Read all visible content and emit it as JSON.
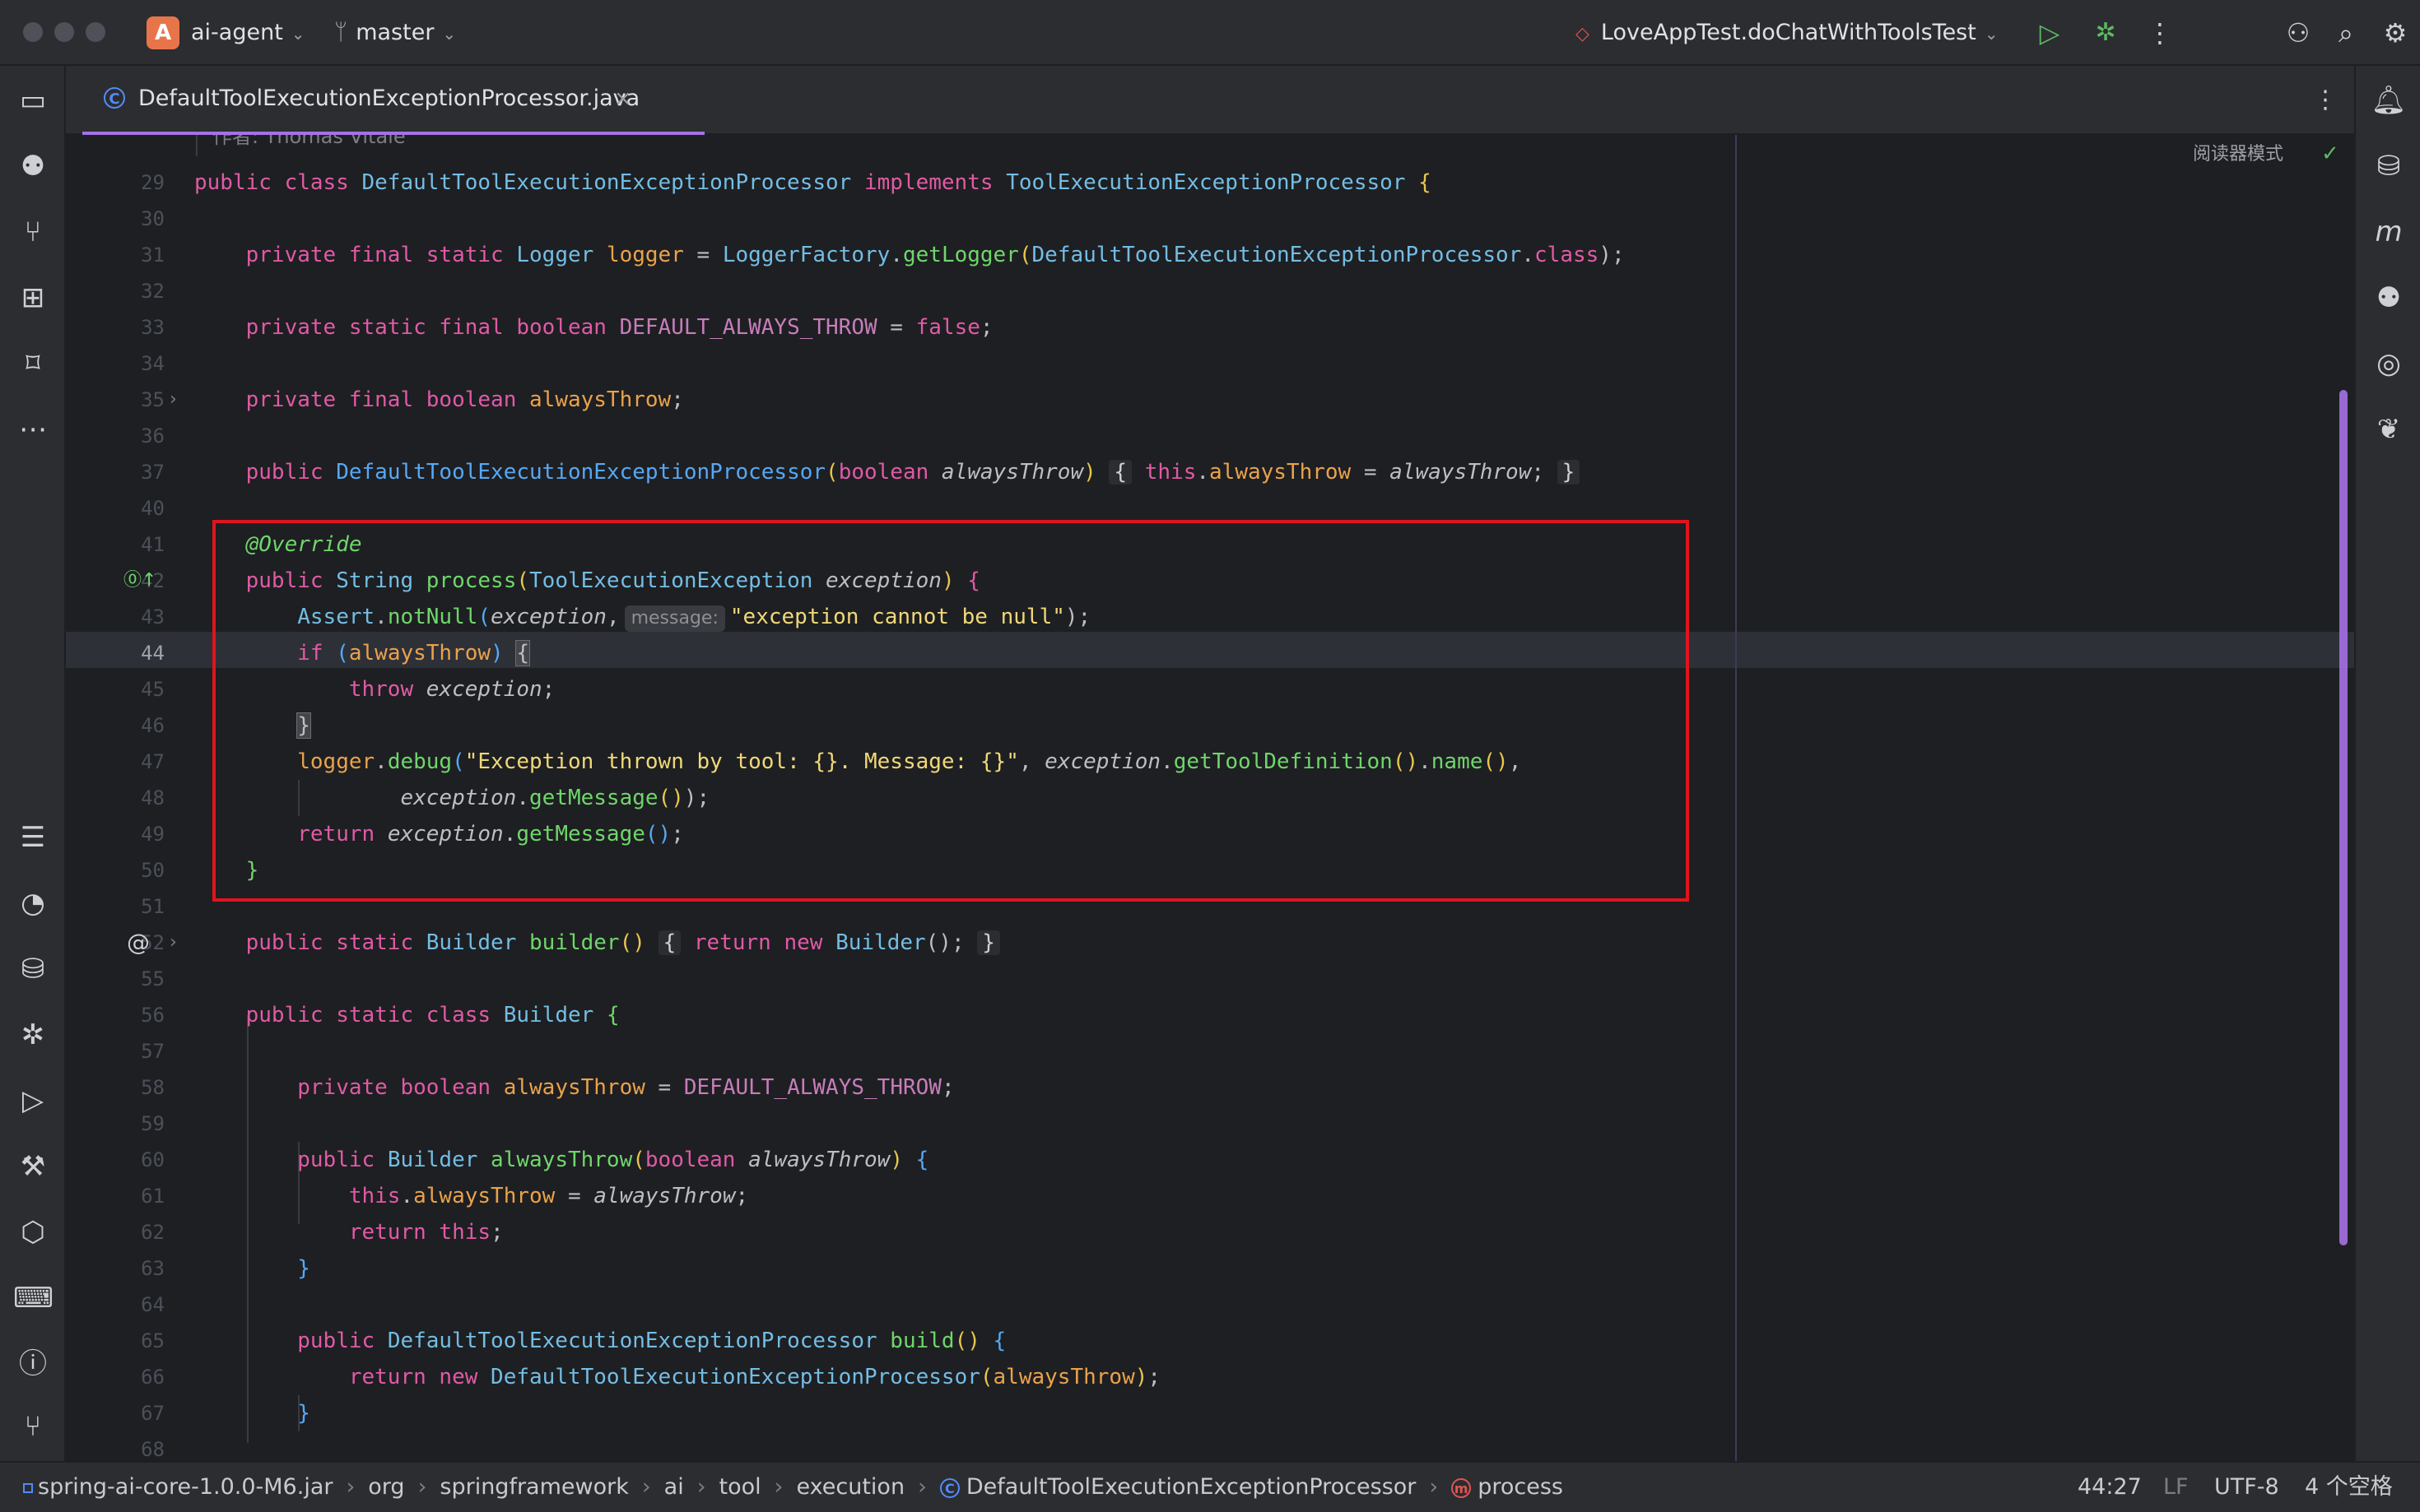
{
  "titlebar": {
    "project_badge": "A",
    "project_name": "ai-agent",
    "branch": "master",
    "run_config": "LoveAppTest.doChatWithToolsTest"
  },
  "tab": {
    "filename": "DefaultToolExecutionExceptionProcessor.java",
    "close": "×",
    "file_icon_letter": "C"
  },
  "editor": {
    "reader_mode": "阅读器模式",
    "header_partial": "作者: Thomas Vitale",
    "current_line": 44,
    "gutter": [
      "29",
      "30",
      "31",
      "32",
      "33",
      "34",
      "35",
      "36",
      "37",
      "40",
      "41",
      "42",
      "43",
      "44",
      "45",
      "46",
      "47",
      "48",
      "49",
      "50",
      "51",
      "52",
      "55",
      "56",
      "57",
      "58",
      "59",
      "60",
      "61",
      "62",
      "63",
      "64",
      "65",
      "66",
      "67",
      "68"
    ]
  },
  "code": {
    "l29": {
      "kw": "public class",
      "cls": "DefaultToolExecutionExceptionProcessor",
      "impl": "implements",
      "iface": "ToolExecutionExceptionProcessor",
      "b": "{"
    },
    "l31": {
      "kw": "private final static",
      "ty": "Logger",
      "f": "logger",
      "eq": " = ",
      "c": "LoggerFactory",
      "m": "getLogger",
      "arg": "DefaultToolExecutionExceptionProcessor",
      "cls": "class",
      "end": ");"
    },
    "l33": {
      "kw": "private static final boolean",
      "f": "DEFAULT_ALWAYS_THROW",
      "eq": " = ",
      "v": "false",
      "end": ";"
    },
    "l35": {
      "kw": "private final boolean",
      "f": "alwaysThrow",
      "end": ";"
    },
    "l37": {
      "kw": "public",
      "ctor": "DefaultToolExecutionExceptionProcessor",
      "ptype": "boolean",
      "p": "alwaysThrow",
      "this": "this",
      "f": "alwaysThrow",
      "eq": " = ",
      "p2": "alwaysThrow",
      "end": ";"
    },
    "l41": {
      "ann": "@Override"
    },
    "l42": {
      "kw": "public",
      "ty": "String",
      "m": "process",
      "ptype": "ToolExecutionException",
      "p": "exception"
    },
    "l43": {
      "c": "Assert",
      "m": "notNull",
      "p": "exception",
      "hint": "message:",
      "s": "\"exception cannot be null\"",
      "end": ");"
    },
    "l44": {
      "kw": "if",
      "f": "alwaysThrow"
    },
    "l45": {
      "kw": "throw",
      "p": "exception",
      "end": ";"
    },
    "l47": {
      "f": "logger",
      "m": "debug",
      "s": "\"Exception thrown by tool: {}. Message: {}\"",
      "p": "exception",
      "m2": "getToolDefinition",
      "m3": "name"
    },
    "l48": {
      "p": "exception",
      "m": "getMessage",
      "end": ");"
    },
    "l49": {
      "kw": "return",
      "p": "exception",
      "m": "getMessage",
      "end": ";"
    },
    "l52": {
      "kw": "public static",
      "ty": "Builder",
      "m": "builder",
      "kw2": "return new",
      "ty2": "Builder",
      "end": "();"
    },
    "l56": {
      "kw": "public static class",
      "ty": "Builder"
    },
    "l58": {
      "kw": "private boolean",
      "f": "alwaysThrow",
      "eq": " = ",
      "c": "DEFAULT_ALWAYS_THROW",
      "end": ";"
    },
    "l60": {
      "kw": "public",
      "ty": "Builder",
      "m": "alwaysThrow",
      "ptype": "boolean",
      "p": "alwaysThrow"
    },
    "l61": {
      "this": "this",
      "f": "alwaysThrow",
      "eq": " = ",
      "p": "alwaysThrow",
      "end": ";"
    },
    "l62": {
      "kw": "return",
      "this": "this",
      "end": ";"
    },
    "l65": {
      "kw": "public",
      "ty": "DefaultToolExecutionExceptionProcessor",
      "m": "build"
    },
    "l66": {
      "kw": "return new",
      "ty": "DefaultToolExecutionExceptionProcessor",
      "f": "alwaysThrow",
      "end": ";"
    }
  },
  "statusbar": {
    "breadcrumbs": [
      "spring-ai-core-1.0.0-M6.jar",
      "org",
      "springframework",
      "ai",
      "tool",
      "execution",
      "DefaultToolExecutionExceptionProcessor",
      "process"
    ],
    "method_icon_letter": "m",
    "position": "44:27",
    "line_sep": "LF",
    "encoding": "UTF-8",
    "indent": "4 个空格"
  }
}
